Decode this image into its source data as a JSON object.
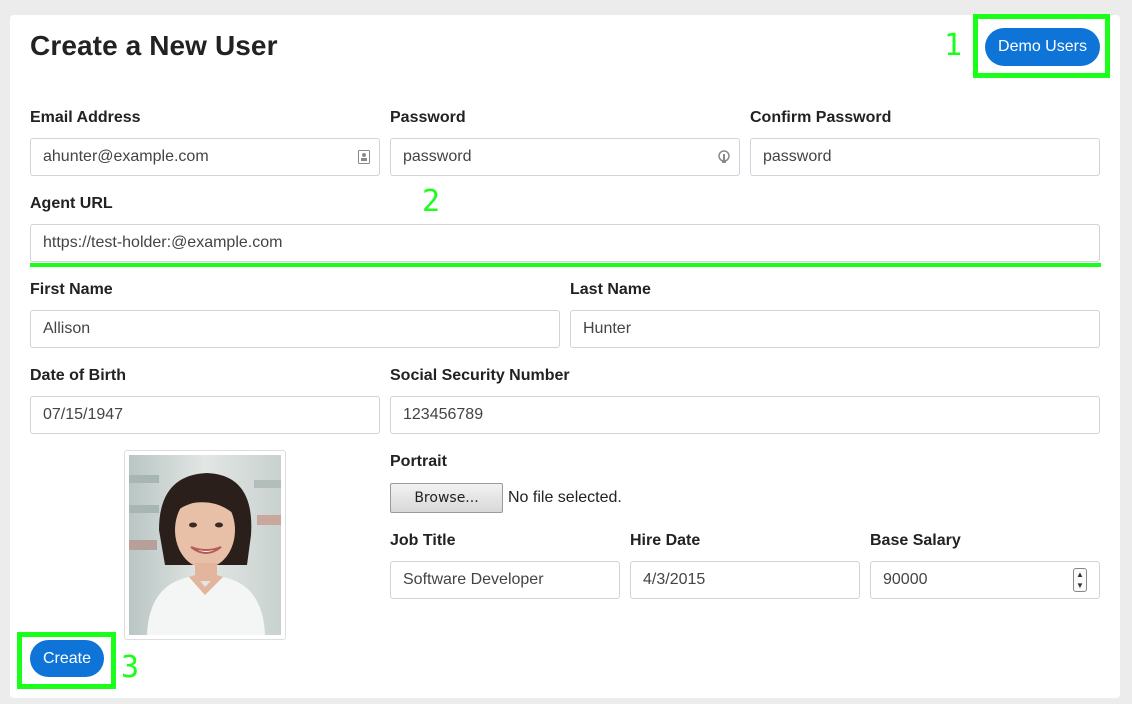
{
  "page": {
    "title": "Create a New User",
    "demo_users_label": "Demo Users",
    "create_label": "Create"
  },
  "annotations": {
    "marker_1": "1",
    "marker_2": "2",
    "marker_3": "3"
  },
  "form": {
    "email": {
      "label": "Email Address",
      "value": "ahunter@example.com"
    },
    "password": {
      "label": "Password",
      "value": "password"
    },
    "confirm_password": {
      "label": "Confirm Password",
      "value": "password"
    },
    "agent_url": {
      "label": "Agent URL",
      "value": "https://test-holder:@example.com"
    },
    "first_name": {
      "label": "First Name",
      "value": "Allison"
    },
    "last_name": {
      "label": "Last Name",
      "value": "Hunter"
    },
    "dob": {
      "label": "Date of Birth",
      "value": "07/15/1947"
    },
    "ssn": {
      "label": "Social Security Number",
      "value": "123456789"
    },
    "portrait": {
      "label": "Portrait",
      "browse_label": "Browse...",
      "file_status": "No file selected."
    },
    "job_title": {
      "label": "Job Title",
      "value": "Software Developer"
    },
    "hire_date": {
      "label": "Hire Date",
      "value": "4/3/2015"
    },
    "base_salary": {
      "label": "Base Salary",
      "value": "90000"
    }
  },
  "colors": {
    "primary": "#0f74d8",
    "highlight": "#1aff1a"
  },
  "icons": {
    "email_field": "contact-card-icon",
    "password_field": "key-icon",
    "portrait_image": "avatar-photo",
    "salary_spinner": "spinner-icon"
  }
}
